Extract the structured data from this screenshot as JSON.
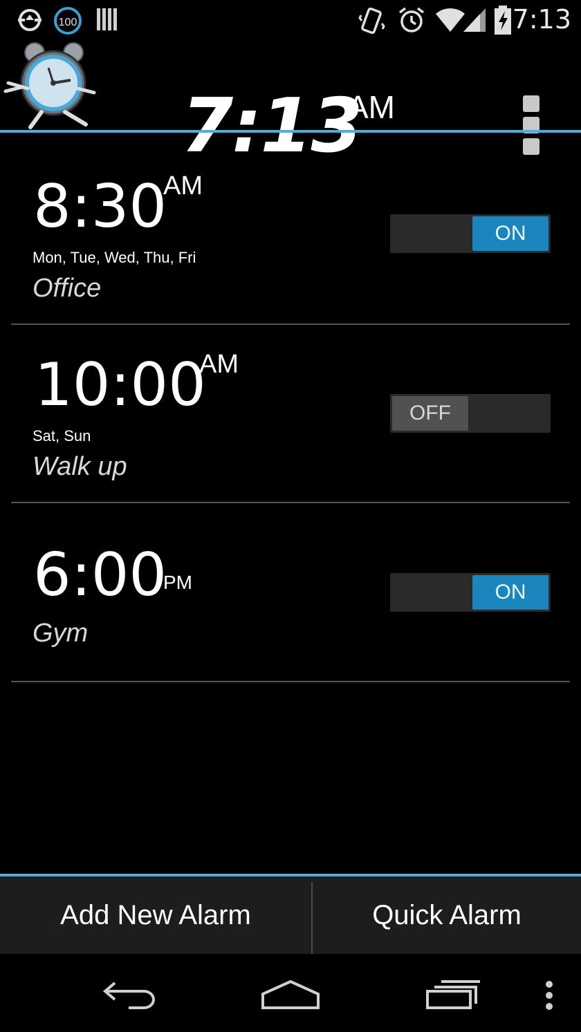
{
  "status_bar": {
    "clock": "7:13",
    "badge": "100",
    "icons": [
      "sync-icon",
      "battery-badge-icon",
      "barcode-icon",
      "vibrate-icon",
      "alarm-icon",
      "wifi-icon",
      "signal-icon",
      "battery-charging-icon"
    ]
  },
  "header": {
    "time": "7:13",
    "ampm": "AM",
    "logo": "running-alarm-clock-logo",
    "menu_icon": "overflow-menu-icon"
  },
  "alarms": [
    {
      "time": "8:30",
      "ampm": "AM",
      "days": "Mon, Tue, Wed, Thu, Fri",
      "label": "Office",
      "state": "ON",
      "enabled": true
    },
    {
      "time": "10:00",
      "ampm": "AM",
      "days": "Sat, Sun",
      "label": "Walk up",
      "state": "OFF",
      "enabled": false
    },
    {
      "time": "6:00",
      "ampm": "PM",
      "days": "",
      "label": "Gym",
      "state": "ON",
      "enabled": true
    }
  ],
  "bottom_bar": {
    "add_label": "Add New Alarm",
    "quick_label": "Quick Alarm"
  },
  "colors": {
    "accent": "#5ba7d6",
    "toggle_on": "#1a86bd",
    "toggle_off": "#515151"
  }
}
